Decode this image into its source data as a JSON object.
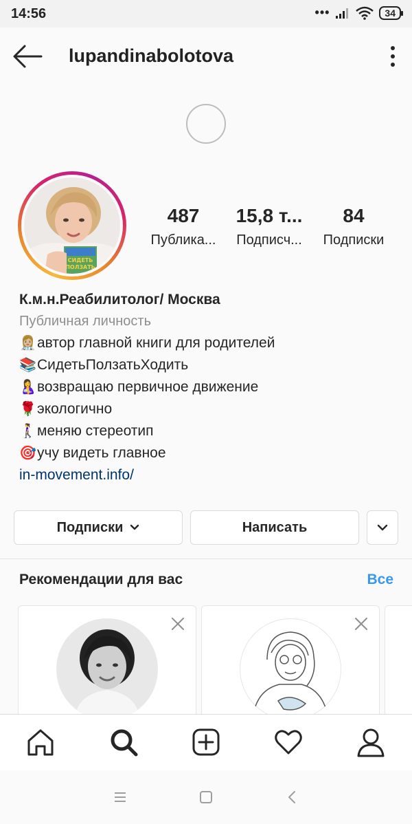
{
  "status_bar": {
    "time": "14:56",
    "more_indicator": "•••",
    "battery": "34"
  },
  "header": {
    "username": "lupandinabolotova",
    "back_icon": "arrow-left-icon",
    "more_icon": "vertical-dots-icon"
  },
  "stats": [
    {
      "value": "487",
      "label": "Публика..."
    },
    {
      "value": "15,8 т...",
      "label": "Подписч..."
    },
    {
      "value": "84",
      "label": "Подписки"
    }
  ],
  "bio": {
    "name": "К.м.н.Реабилитолог/ Москва",
    "category": "Публичная личность",
    "lines": [
      {
        "emoji": "👩🏼‍⚕️",
        "text": "автор главной книги для родителей"
      },
      {
        "emoji": "📚",
        "text": "СидетьПолзатьХодить"
      },
      {
        "emoji": "🤱",
        "text": "возвращаю первичное движение"
      },
      {
        "emoji": "🌹",
        "text": "экологично"
      },
      {
        "emoji": "🚶‍♀️",
        "text": "меняю стереотип"
      },
      {
        "emoji": "🎯",
        "text": "учу видеть главное"
      }
    ],
    "link": "in-movement.info/"
  },
  "actions": {
    "following_label": "Подписки",
    "message_label": "Написать"
  },
  "recommendations": {
    "title": "Рекомендации для вас",
    "see_all": "Все"
  },
  "book_cover_text": "СИДЕТЬ ПОЛЗАТЬ ХОДИТЬ",
  "colors": {
    "link": "#003569",
    "accent_blue": "#3897f0",
    "story_ring_start": "#f5b93d",
    "story_ring_end": "#b8208f"
  },
  "bottom_nav": [
    "home-icon",
    "search-icon",
    "add-post-icon",
    "heart-icon",
    "profile-icon"
  ],
  "system_nav": [
    "menu-icon",
    "home-square-icon",
    "back-chevron-icon"
  ]
}
